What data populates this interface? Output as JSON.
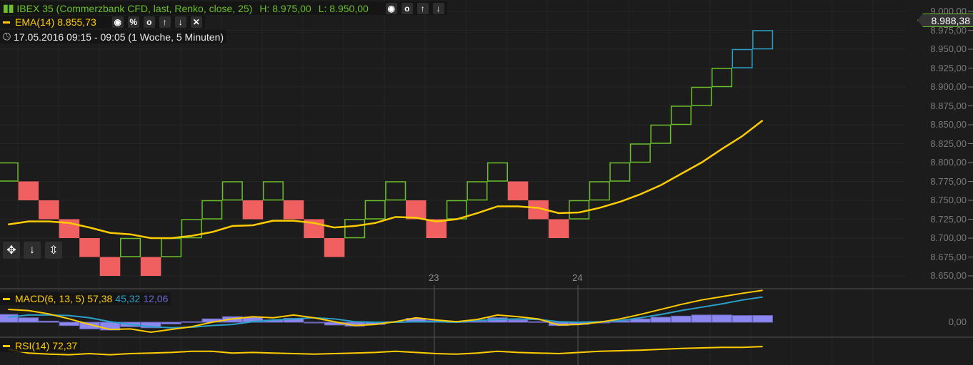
{
  "header": {
    "instrument_label": "IBEX 35 (Commerzbank CFD, last, Renko, close, 25)",
    "high_label": "H: 8.975,00",
    "low_label": "L: 8.950,00",
    "instrument_icons": [
      "eye-icon",
      "circle-icon",
      "arrow-up-icon",
      "arrow-down-icon"
    ],
    "ema_label": "EMA(14)",
    "ema_value": "8.855,73",
    "ema_icons": [
      "eye-icon",
      "link-icon",
      "circle-icon",
      "arrow-up-icon",
      "arrow-down-icon",
      "close-icon"
    ],
    "time_range": "17.05.2016 09:15 - 09:05 (1 Woche, 5 Minuten)"
  },
  "colors": {
    "up": "#6abf2a",
    "down": "#f06060",
    "current": "#2aa0c8",
    "ema": "#ffcc00",
    "macd": "#ffcc00",
    "signal": "#2aa0c8",
    "hist": "#8c88f0",
    "rsi": "#ffcc00",
    "instrument_text": "#6abf2a"
  },
  "price_axis": {
    "labels": [
      "9.000,00",
      "8.975,00",
      "8.950,00",
      "8.925,00",
      "8.900,00",
      "8.875,00",
      "8.850,00",
      "8.825,00",
      "8.800,00",
      "8.775,00",
      "8.750,00",
      "8.725,00",
      "8.700,00",
      "8.675,00",
      "8.650,00"
    ],
    "current_price": "8.988,38"
  },
  "time_axis": {
    "labels": [
      "23",
      "24"
    ]
  },
  "chart_data": {
    "type": "renko",
    "brick_size": 25,
    "bricks": [
      {
        "dir": "up",
        "low": 8775
      },
      {
        "dir": "down",
        "low": 8750
      },
      {
        "dir": "down",
        "low": 8725
      },
      {
        "dir": "down",
        "low": 8700
      },
      {
        "dir": "down",
        "low": 8675
      },
      {
        "dir": "down",
        "low": 8650
      },
      {
        "dir": "up",
        "low": 8675
      },
      {
        "dir": "down",
        "low": 8650
      },
      {
        "dir": "up",
        "low": 8675
      },
      {
        "dir": "up",
        "low": 8700
      },
      {
        "dir": "up",
        "low": 8725
      },
      {
        "dir": "up",
        "low": 8750
      },
      {
        "dir": "down",
        "low": 8725
      },
      {
        "dir": "up",
        "low": 8750
      },
      {
        "dir": "down",
        "low": 8725
      },
      {
        "dir": "down",
        "low": 8700
      },
      {
        "dir": "down",
        "low": 8675
      },
      {
        "dir": "up",
        "low": 8700
      },
      {
        "dir": "up",
        "low": 8725
      },
      {
        "dir": "up",
        "low": 8750
      },
      {
        "dir": "down",
        "low": 8725
      },
      {
        "dir": "down",
        "low": 8700
      },
      {
        "dir": "up",
        "low": 8725
      },
      {
        "dir": "up",
        "low": 8750
      },
      {
        "dir": "up",
        "low": 8775
      },
      {
        "dir": "down",
        "low": 8750
      },
      {
        "dir": "down",
        "low": 8725
      },
      {
        "dir": "down",
        "low": 8700
      },
      {
        "dir": "up",
        "low": 8725
      },
      {
        "dir": "up",
        "low": 8750
      },
      {
        "dir": "up",
        "low": 8775
      },
      {
        "dir": "up",
        "low": 8800
      },
      {
        "dir": "up",
        "low": 8825
      },
      {
        "dir": "up",
        "low": 8850
      },
      {
        "dir": "up",
        "low": 8875
      },
      {
        "dir": "up",
        "low": 8900
      },
      {
        "dir": "current",
        "low": 8925
      },
      {
        "dir": "current",
        "low": 8950
      }
    ],
    "ema14": [
      8718,
      8722,
      8722,
      8720,
      8714,
      8707,
      8705,
      8700,
      8700,
      8703,
      8708,
      8716,
      8717,
      8723,
      8723,
      8720,
      8714,
      8716,
      8720,
      8728,
      8727,
      8722,
      8725,
      8733,
      8742,
      8742,
      8740,
      8733,
      8734,
      8740,
      8748,
      8758,
      8770,
      8785,
      8800,
      8818,
      8835,
      8855.73
    ],
    "ylim": [
      8650,
      9000
    ]
  },
  "macd": {
    "label": "MACD(6, 13, 5)",
    "macd_value": "57,38",
    "signal_value": "45,32",
    "hist_value": "12,06",
    "zero_label": "0,00",
    "macd": [
      23,
      21,
      15,
      6,
      -4,
      -13,
      -12,
      -18,
      -13,
      -8,
      0,
      6,
      10,
      8,
      13,
      8,
      1,
      -6,
      -4,
      1,
      8,
      4,
      1,
      5,
      13,
      10,
      6,
      -5,
      -4,
      0,
      6,
      14,
      23,
      32,
      40,
      46,
      52,
      57.38
    ],
    "signal": [
      9,
      13,
      13,
      12,
      8,
      1,
      -4,
      -8,
      -10,
      -9,
      -6,
      -4,
      1,
      4,
      6,
      8,
      6,
      1,
      0,
      0,
      1,
      1,
      0,
      3,
      5,
      6,
      5,
      1,
      0,
      1,
      3,
      8,
      14,
      21,
      27,
      33,
      40,
      45.32
    ]
  },
  "rsi": {
    "label": "RSI(14)",
    "value": "72,37",
    "values": [
      67.5,
      61,
      59,
      58,
      60,
      58,
      60,
      61,
      62,
      64,
      64,
      61,
      62,
      61,
      60,
      59,
      60,
      61,
      62,
      64,
      62,
      60,
      59,
      61,
      64,
      62,
      61,
      60,
      62,
      64,
      65,
      66,
      67.5,
      69,
      70,
      71,
      71,
      72.37
    ]
  },
  "tools": [
    "move-icon",
    "arrow-down-icon",
    "collapse-icon"
  ]
}
